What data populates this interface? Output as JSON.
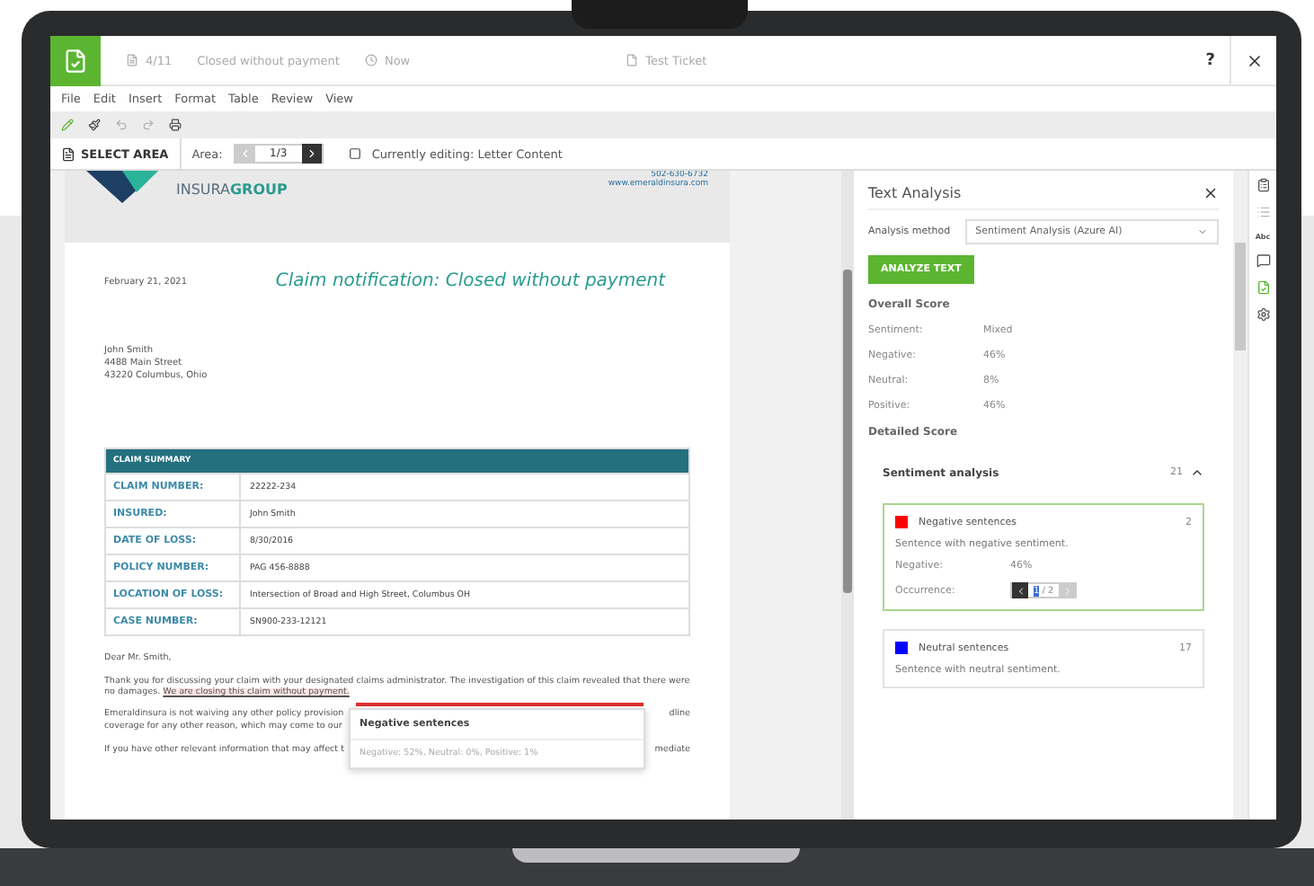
{
  "title_bar": {
    "doc_id": "4/11",
    "status": "Closed without payment",
    "time": "Now",
    "ticket": "Test Ticket",
    "help": "?"
  },
  "menu": [
    "File",
    "Edit",
    "Insert",
    "Format",
    "Table",
    "Review",
    "View"
  ],
  "area_bar": {
    "select_area": "SELECT AREA",
    "area_label": "Area:",
    "area_value": "1/3",
    "editing": "Currently editing: Letter Content"
  },
  "letter": {
    "brand": "INSURA**GROUP**",
    "phone": "502-630-6732",
    "website": "www.emeraldinsura.com",
    "date": "February 21, 2021",
    "heading": "Claim notification: Closed without payment",
    "address": [
      "John Smith",
      "4488 Main Street",
      "43220 Columbus,  Ohio"
    ],
    "table_title": "CLAIM SUMMARY",
    "rows": [
      {
        "label": "CLAIM NUMBER:",
        "value": "22222-234"
      },
      {
        "label": "INSURED:",
        "value": "John Smith"
      },
      {
        "label": "DATE OF LOSS:",
        "value": "8/30/2016"
      },
      {
        "label": "POLICY NUMBER:",
        "value": "PAG 456-8888"
      },
      {
        "label": "LOCATION OF LOSS:",
        "value": "Intersection of Broad and High Street, Columbus OH"
      },
      {
        "label": "CASE NUMBER:",
        "value": "SN900-233-12121"
      }
    ],
    "salutation": "Dear Mr. Smith,",
    "paragraph": {
      "text": "Thank you for discussing your claim with your designated claims administrator.  The investigation of this claim revealed that there were no damages.",
      "highlight": "We are closing this claim without payment."
    },
    "covered_lines": [
      {
        "left": "Emeraldinsura is not waiving any other policy provision",
        "right": "dline"
      },
      {
        "left": "coverage for any other reason, which may come to our"
      },
      {
        "left": "If you have other relevant information that may affect t",
        "right": "mediate"
      }
    ]
  },
  "popover": {
    "title": "Negative sentences",
    "detail": "Negative: 52%, Neutral: 0%, Positive: 1%"
  },
  "panel": {
    "title": "Text Analysis",
    "method_label": "Analysis method",
    "method_value": "Sentiment Analysis (Azure AI)",
    "button": "ANALYZE TEXT",
    "overall_title": "Overall Score",
    "scores": [
      {
        "label": "Sentiment:",
        "value": "Mixed"
      },
      {
        "label": "Negative:",
        "value": "46%"
      },
      {
        "label": "Neutral:",
        "value": "8%"
      },
      {
        "label": "Positive:",
        "value": "46%"
      }
    ],
    "detailed_title": "Detailed Score",
    "section": {
      "title": "Sentiment analysis",
      "count": "21",
      "expanded": true
    },
    "groups": [
      {
        "name": "Negative sentences",
        "count": "2",
        "color": "#ff0000",
        "selected": true,
        "description": "Sentence with negative sentiment.",
        "negative_label": "Negative:",
        "negative_value": "46%",
        "occurrence_label": "Occurrence:",
        "occurrence_value": "1",
        "occurrence_total": "/ 2"
      },
      {
        "name": "Neutral sentences",
        "count": "17",
        "color": "#0000ff",
        "selected": false,
        "description": "Sentence with neutral sentiment."
      }
    ]
  },
  "side_tools": {
    "abc_label": "Abc"
  }
}
